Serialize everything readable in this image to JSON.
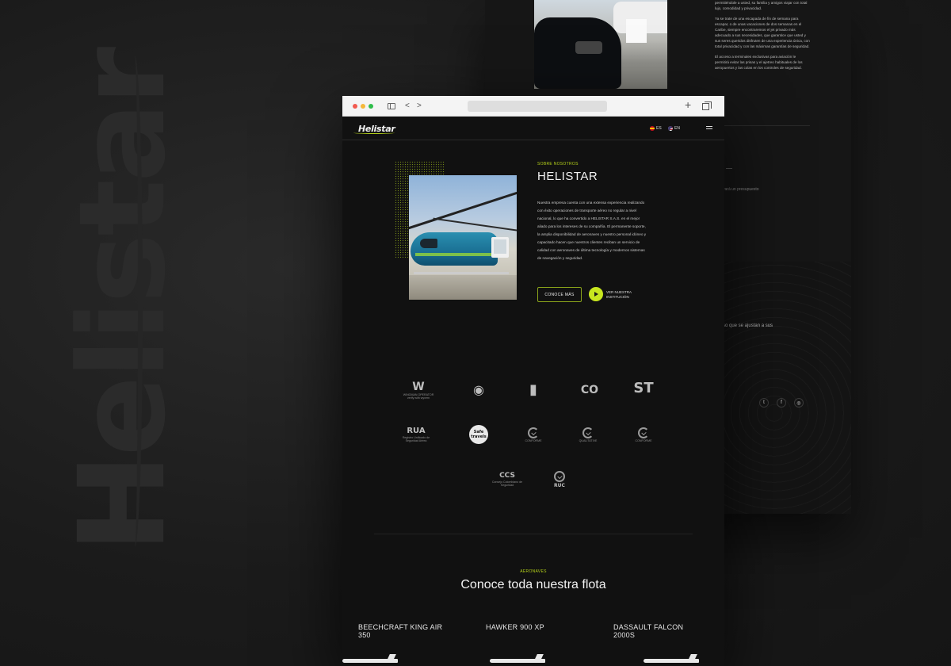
{
  "watermark": {
    "text": "Helistar"
  },
  "back_page": {
    "paragraphs": [
      "permitiéndole a usted, su familia y amigos viajar con total lujo, comodidad y privacidad.",
      "Ya se trate de una escapada de fin de semana para escapar, o de unas vacaciones de dos semanas en el Caribe, siempre encontraremos el jet privado más adecuado a sus necesidades, que garantice que usted y sus seres queridos disfruten de una experiencia única, con total privacidad y con las máximas garantías de seguridad.",
      "El acceso a terminales exclusivas para aviación le permitirá evitar las prisas y el ajetreo habituales de los aeropuertos y las colas en los controles de seguridad."
    ],
    "small_text": "vará un presupuesto",
    "text2": "so que se ajustan a sus",
    "socials": [
      "twitter-icon",
      "facebook-icon",
      "instagram-icon"
    ]
  },
  "browser": {
    "nav": {
      "back": "<",
      "forward": ">",
      "new_tab": "+"
    }
  },
  "header": {
    "logo": "Helistar",
    "languages": [
      {
        "code": "ES",
        "flag": "es-flag-icon"
      },
      {
        "code": "EN",
        "flag": "us-flag-icon"
      }
    ],
    "menu_icon": "hamburger-icon"
  },
  "about": {
    "eyebrow": "SOBRE NOSOTROS",
    "title": "HELISTAR",
    "body": "Nuestra empresa cuenta con una extensa experiencia realizando con éxito operaciones de transporte aéreo no regular a nivel nacional, lo que ha convertido a HELISTAR S.A.S. en el mejor aliado para los intereses de su compañía. El permanente soporte, la amplia disponibilidad de aeronaves y nuestro personal idóneo y capacitado hacen que nuestros clientes reciban un servicio de calidad con aeronaves de última tecnología y modernos sistemas de navegación y seguridad.",
    "cta_label": "CONOCE MÁS",
    "video_label": "VER NUESTRA INSTITUCIÓN"
  },
  "certifications": [
    {
      "name": "wyvern-operator-logo",
      "glyph": "W",
      "caption": "WINGMAN OPERATOR verify with wyvern"
    },
    {
      "name": "seal-logo",
      "glyph": "◉",
      "caption": ""
    },
    {
      "name": "bookmark-badge-logo",
      "glyph": "▮",
      "caption": ""
    },
    {
      "name": "co-logo",
      "glyph": "CO",
      "caption": ""
    },
    {
      "name": "st-logo",
      "glyph": "ST",
      "caption": ""
    },
    {
      "name": "rua-logo",
      "glyph": "RUA",
      "caption": "Registro Unificado de Seguridad Aérea"
    },
    {
      "name": "safe-travels-logo",
      "glyph": "Safe travels",
      "caption": ""
    },
    {
      "name": "iso-cert-1-logo",
      "glyph": "",
      "caption": "CONFORME"
    },
    {
      "name": "iso-cert-2-logo",
      "glyph": "",
      "caption": "QUALITATIVE"
    },
    {
      "name": "iso-cert-3-logo",
      "glyph": "",
      "caption": "CONFORME"
    },
    {
      "name": "ccs-logo",
      "glyph": "CCS",
      "caption": "Consejo Colombiano de Seguridad"
    },
    {
      "name": "ruc-logo",
      "glyph": "RUC",
      "caption": ""
    }
  ],
  "fleet": {
    "eyebrow": "AERONAVES",
    "title": "Conoce toda nuestra flota",
    "aircraft": [
      {
        "name": "BEECHCRAFT KING AIR 350"
      },
      {
        "name": "HAWKER 900 XP"
      },
      {
        "name": "DASSAULT FALCON 2000S"
      }
    ]
  },
  "colors": {
    "accent": "#b5d11a",
    "background": "#111111",
    "play": "#c8e61f"
  }
}
